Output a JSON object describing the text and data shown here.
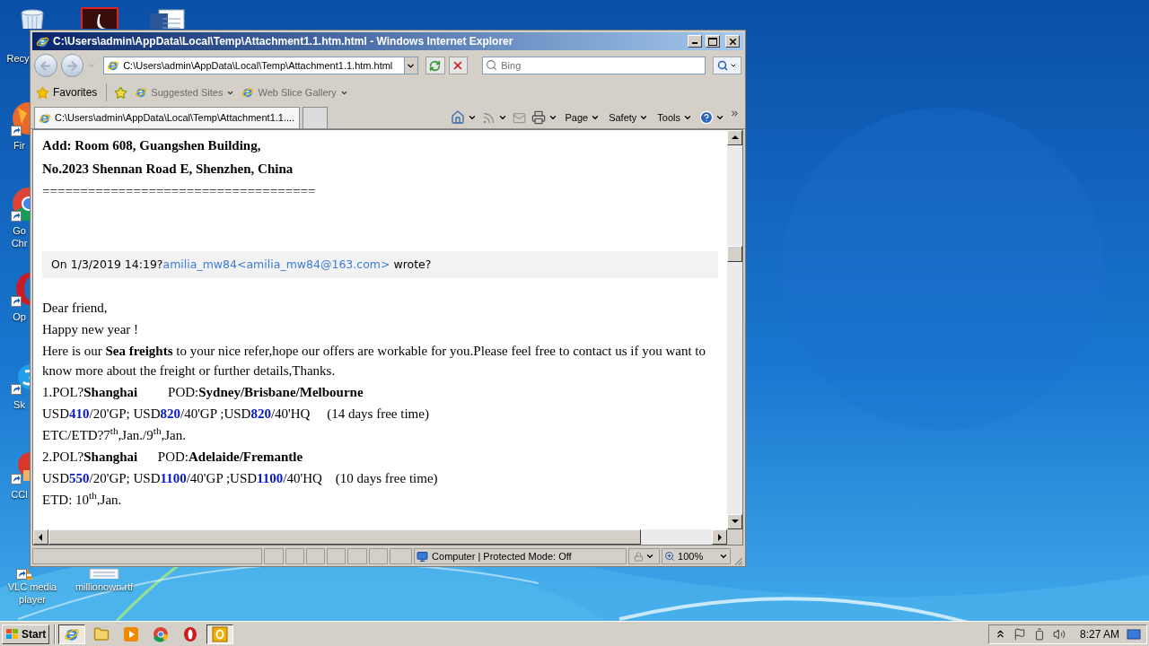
{
  "desktop_icons": [
    {
      "kind": "trash",
      "label": "Recy",
      "shortcut": false
    },
    {
      "kind": "pdf",
      "shortcut": false
    },
    {
      "kind": "word",
      "shortcut": false
    },
    {
      "kind": "fox",
      "label": "Fir",
      "shortcut": true
    },
    {
      "kind": "ring",
      "label": "Go Chr",
      "shortcut": true
    },
    {
      "kind": "o",
      "label": "Op",
      "shortcut": true
    },
    {
      "kind": "cloud",
      "label": "Sk",
      "shortcut": true
    },
    {
      "kind": "broom",
      "label": "CCl",
      "shortcut": true
    },
    {
      "kind": "cone",
      "label": "VLC media player",
      "shortcut": true
    },
    {
      "kind": "doc",
      "label": "millionown.rtf",
      "shortcut": false
    }
  ],
  "window": {
    "title": "C:\\Users\\admin\\AppData\\Local\\Temp\\Attachment1.1.htm.html - Windows Internet Explorer",
    "address": "C:\\Users\\admin\\AppData\\Local\\Temp\\Attachment1.1.htm.html",
    "search": {
      "placeholder": "Bing"
    },
    "favorites_bar": {
      "label": "Favorites",
      "links": [
        "Suggested Sites",
        "Web Slice Gallery"
      ]
    },
    "tabs": [
      {
        "label": "C:\\Users\\admin\\AppData\\Local\\Temp\\Attachment1.1....",
        "selected": true
      }
    ],
    "command_bar": [
      "Page",
      "Safety",
      "Tools"
    ],
    "status_bar": {
      "zone": "Computer | Protected Mode: Off",
      "zoom": "100%"
    }
  },
  "content": {
    "signature": [
      "Add: Room 608, Guangshen Building,",
      "No.2023 Shennan Road E, Shenzhen, China"
    ],
    "separator": "====================================",
    "quote_header": {
      "prefix": "On 1/3/2019 14:19?",
      "link": "amilia_mw84<amilia_mw84@163.com>",
      "suffix": "wrote?"
    },
    "body": [
      {
        "kind": "text",
        "text": "Dear friend,"
      },
      {
        "kind": "text",
        "text": "Happy new year !"
      },
      {
        "kind": "text",
        "text": "Here is our **Sea freights** to your nice refer,hope our offers are workable for you.Please feel free to contact us if you want to know more about the freight or further details,Thanks."
      },
      {
        "kind": "text",
        "text": "1.POL?**Shanghai**         POD:**Sydney/Brisbane/Melbourne**"
      },
      {
        "kind": "price",
        "text": "USD**410**/20'GP; USD**820**/40'GP ;USD**820**/40'HQ     (14 days free time)"
      },
      {
        "kind": "text",
        "text": "ETC/ETD?7$^{th}$,Jan./9$^{th}$,Jan."
      },
      {
        "kind": "text",
        "text": "2.POL?**Shanghai**      POD:**Adelaide/Fremantle**"
      },
      {
        "kind": "price",
        "text": "USD**550**/20'GP; USD**1100**/40'GP ;USD**1100**/40'HQ    (10 days free time)"
      },
      {
        "kind": "text",
        "text": "ETD: 10$^{th}$,Jan."
      }
    ]
  },
  "taskbar": {
    "start": "Start",
    "items": [
      {
        "kind": "ie",
        "selected": true
      },
      {
        "kind": "folder",
        "selected": false
      },
      {
        "kind": "media",
        "selected": false
      },
      {
        "kind": "ring",
        "selected": false
      },
      {
        "kind": "o",
        "selected": false
      },
      {
        "kind": "mail",
        "selected": true
      }
    ],
    "clock": "8:27 AM"
  }
}
